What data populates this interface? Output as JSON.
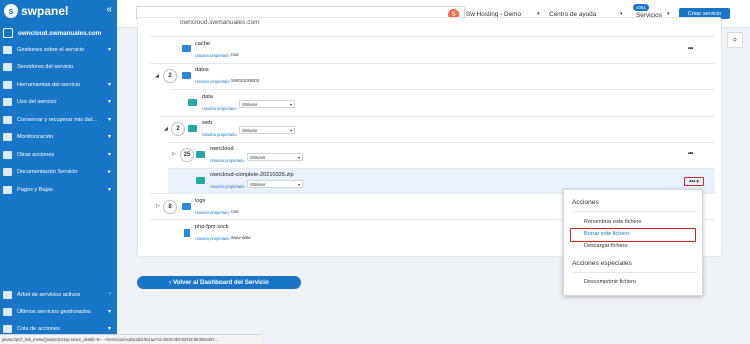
{
  "app": {
    "logo_text": "swpanel",
    "collapse": "«"
  },
  "sidebar": {
    "domain": "owncloud.swmanuales.com",
    "items": [
      {
        "label": "Gestiones sobre el servicio",
        "chev": "▾"
      },
      {
        "label": "Servidores del servicio",
        "chev": ""
      },
      {
        "label": "Herramientas del servicio",
        "chev": "▾"
      },
      {
        "label": "Uso del servicio",
        "chev": "▾"
      },
      {
        "label": "Conservar y recuperar mis dat...",
        "chev": "▾"
      },
      {
        "label": "Monitorización",
        "chev": "▾"
      },
      {
        "label": "Otras acciones",
        "chev": "▾"
      },
      {
        "label": "Documentación Servicio",
        "chev": "▸"
      },
      {
        "label": "Pagos y Bajas",
        "chev": "▾"
      }
    ],
    "bottom": [
      {
        "label": "Árbol de servicios activos",
        "chev": "›"
      },
      {
        "label": "Últimos servicios gestionados",
        "chev": "▾"
      },
      {
        "label": "Cola de acciones",
        "chev": "▾"
      }
    ]
  },
  "topbar": {
    "search_placeholder": "",
    "avatar": "S",
    "account": "Sw Hosting - Demo",
    "help": "Centro de ayuda",
    "help_badge": "1061",
    "services": "Servicios",
    "create": "Crear servicio"
  },
  "explorer": {
    "top_domain": "owncloud.swmanuales.com",
    "owner_label": "Usuario propietario",
    "rows": [
      {
        "name": "cache",
        "owner": "root"
      },
      {
        "name": "datos",
        "owner": "SW0220W002",
        "count": "2"
      },
      {
        "name": "data",
        "owner": "SWuser"
      },
      {
        "name": "web",
        "owner": "SWuser",
        "count": "2"
      },
      {
        "name": "owncloud",
        "owner": "SWuser",
        "count": "25"
      },
      {
        "name": "owncloud-complete-20210326.zip",
        "owner": "SWuser"
      },
      {
        "name": "logs",
        "owner": "root",
        "count": "8"
      },
      {
        "name": "php-fpm.sock",
        "owner": "www-data"
      }
    ]
  },
  "menu": {
    "heading1": "Acciones",
    "item1": "Renombrar este fichero",
    "item2": "Borrar este fichero",
    "item3": "Descargar fichero",
    "heading2": "Acciones especiales",
    "item4": "Descomprimir fichero"
  },
  "back_button": "‹  Volver al Dashboard del Servicio",
  "status_url": "javascript:if_link_menu('javascript:top.seure_detall(~8~..~/servicios/explorador/borrar?ct=523C4DC8376C6E3955397...",
  "colors": {
    "accent": "#1976c7",
    "highlight": "#c62828"
  }
}
